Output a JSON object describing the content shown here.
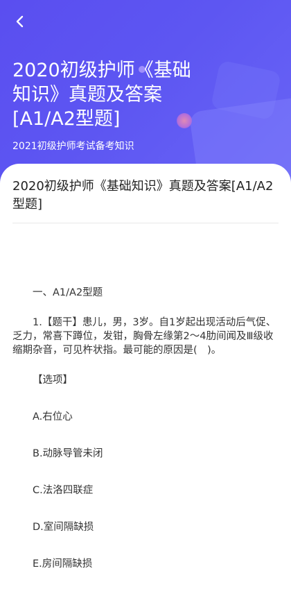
{
  "header": {
    "back_icon": "chevron-left-icon",
    "title": "2020初级护师《基础知识》真题及答案[A1/A2型题]",
    "subtitle": "2021初级护师考试备考知识",
    "colors": {
      "gradient_start": "#5a4ef0",
      "gradient_end": "#6a66f6"
    }
  },
  "article": {
    "title": "2020初级护师《基础知识》真题及答案[A1/A2型题]",
    "section_heading": "一、A1/A2型题",
    "question": "1.【题干】患儿，男，3岁。自1岁起出现活动后气促、乏力，常喜下蹲位，发钳，胸骨左缘第2～4肋间闻及Ⅲ级收缩期杂音，可见杵状指。最可能的原因是(　)。",
    "options_label": "【选项】",
    "options": [
      "A.右位心",
      "B.动脉导管未闭",
      "C.法洛四联症",
      "D.室间隔缺损",
      "E.房间隔缺损"
    ]
  }
}
